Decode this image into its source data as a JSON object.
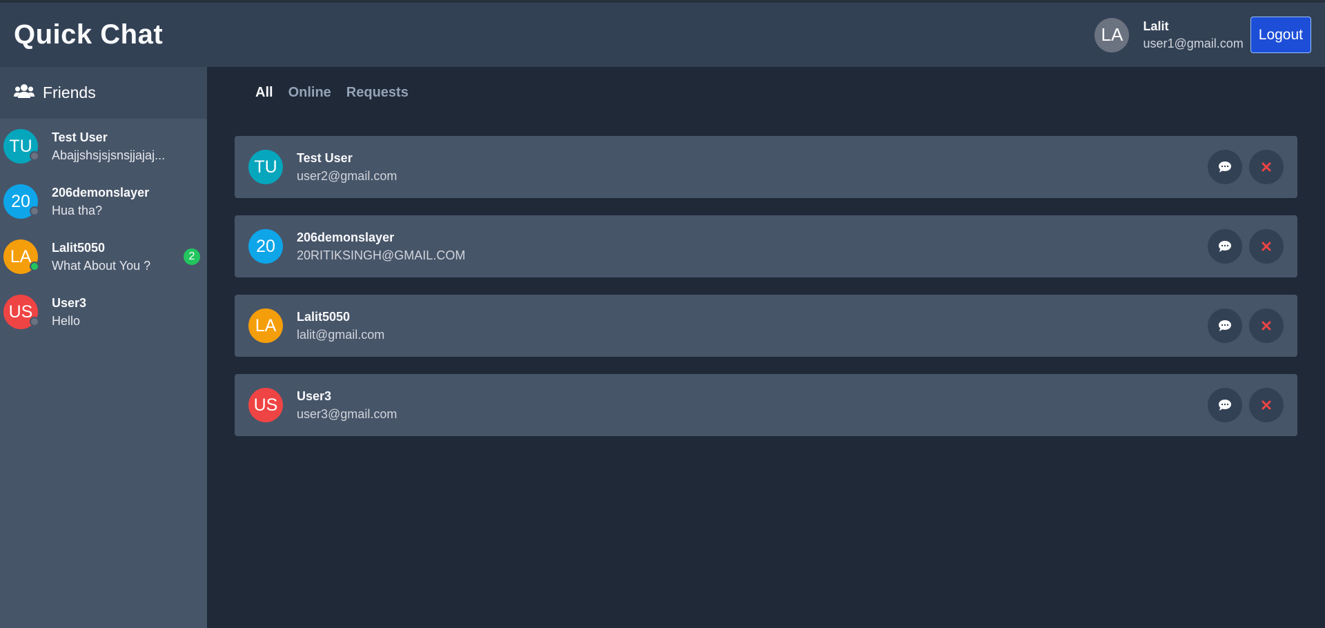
{
  "app": {
    "title": "Quick Chat"
  },
  "user": {
    "initials": "LA",
    "name": "Lalit",
    "email": "user1@gmail.com",
    "avatar_color": "#6b7280"
  },
  "header": {
    "logout_label": "Logout"
  },
  "sidebar": {
    "title": "Friends",
    "icon": "users-icon",
    "chats": [
      {
        "initials": "TU",
        "name": "Test User",
        "last_message": "Abajjshsjsjsnsjjajaj...",
        "color": "#06a6bd",
        "status": "offline",
        "unread": ""
      },
      {
        "initials": "20",
        "name": "206demonslayer",
        "last_message": "Hua tha?",
        "color": "#0ea5e9",
        "status": "offline",
        "unread": ""
      },
      {
        "initials": "LA",
        "name": "Lalit5050",
        "last_message": "What About You ?",
        "color": "#f59e0b",
        "status": "online",
        "unread": "2"
      },
      {
        "initials": "US",
        "name": "User3",
        "last_message": "Hello",
        "color": "#ef4444",
        "status": "offline",
        "unread": ""
      }
    ]
  },
  "tabs": [
    {
      "label": "All",
      "active": true
    },
    {
      "label": "Online",
      "active": false
    },
    {
      "label": "Requests",
      "active": false
    }
  ],
  "friends": [
    {
      "initials": "TU",
      "name": "Test User",
      "email": "user2@gmail.com",
      "color": "#06a6bd"
    },
    {
      "initials": "20",
      "name": "206demonslayer",
      "email": "20RITIKSINGH@GMAIL.COM",
      "color": "#0ea5e9"
    },
    {
      "initials": "LA",
      "name": "Lalit5050",
      "email": "lalit@gmail.com",
      "color": "#f59e0b"
    },
    {
      "initials": "US",
      "name": "User3",
      "email": "user3@gmail.com",
      "color": "#ef4444"
    }
  ],
  "colors": {
    "online": "#22c55e",
    "offline": "#6b7280",
    "remove": "#ef4444",
    "accent": "#1d4ed8"
  },
  "icons": {
    "message": "message-icon",
    "remove": "close-icon"
  }
}
